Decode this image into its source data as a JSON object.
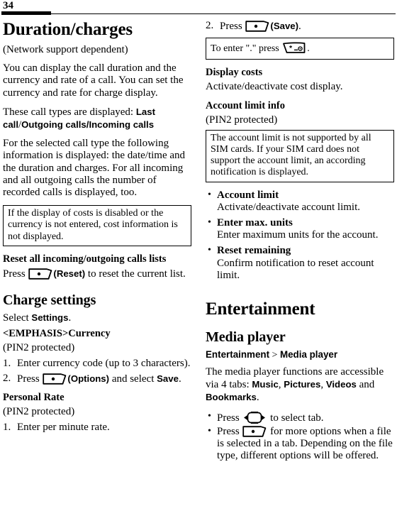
{
  "page": {
    "number": "34"
  },
  "left_column": {
    "chapter_title": "Duration/charges",
    "network_note": "(Network support dependent)",
    "para1": "You can display the call duration and the currency and rate of a call. You can set the currency and rate for charge display.",
    "para2_prefix": "These call types are displayed: ",
    "call_type_1": "Last call",
    "call_type_sep1": "/",
    "call_type_2": "Outgoing calls",
    "call_type_sep2": "/",
    "call_type_3": "Incoming calls",
    "para3": "For the selected call type the following information is displayed: the date/time and the duration and charges. For all incoming and all outgoing calls the number of recorded calls is displayed, too.",
    "note_box_1": "If the display of costs is disabled or the currency is not entered, cost information is not displayed.",
    "reset_heading": "Reset all incoming/outgoing calls lists",
    "reset_press_prefix": "Press ",
    "reset_soft_key": "soft-key-icon",
    "reset_paren_open": "(",
    "reset_label": "Reset",
    "reset_paren_close": ")",
    "reset_suffix": " to reset the current list.",
    "charge_settings_title": "Charge settings",
    "select_prefix": "Select ",
    "select_term": "Settings",
    "select_suffix": ".",
    "currency_heading": "<EMPHASIS>Currency",
    "pin2_note_1": "(PIN2 protected)",
    "currency_steps": [
      {
        "num": "1.",
        "text": "Enter currency code (up to 3 characters)."
      }
    ],
    "currency_step2": {
      "num": "2.",
      "prefix": "Press ",
      "key": "soft-key-icon",
      "paren_open": "(",
      "label": "Options",
      "paren_close": ")",
      "mid": " and select ",
      "label2": "Save",
      "suffix": "."
    },
    "personal_rate_heading": "Personal Rate",
    "pin2_note_2": "(PIN2 protected)",
    "personal_rate_steps": [
      {
        "num": "1.",
        "text": "Enter per minute rate."
      }
    ]
  },
  "right_column": {
    "save_step": {
      "num": "2.",
      "prefix": "Press ",
      "key": "soft-key-icon",
      "paren_open": "(",
      "label": "Save",
      "paren_close": ")",
      "suffix": "."
    },
    "note_box_dot": {
      "prefix": "To enter \".\" press ",
      "key": "star-key-icon",
      "suffix": "."
    },
    "display_costs_heading": "Display costs",
    "display_costs_text": "Activate/deactivate cost display.",
    "account_limit_heading": "Account limit info",
    "pin2_note": "(PIN2 protected)",
    "note_box_account": "The account limit is not supported by all SIM cards. If your SIM card does not support the account limit, an according notification is displayed.",
    "bullets": [
      {
        "title": "Account limit",
        "text": "Activate/deactivate account limit."
      },
      {
        "title": "Enter max. units",
        "text": "Enter maximum units for the account."
      },
      {
        "title": "Reset remaining",
        "text": "Confirm notification to reset account limit."
      }
    ],
    "entertainment_title": "Entertainment",
    "media_player_title": "Media player",
    "breadcrumb_parent": "Entertainment",
    "breadcrumb_sep": " > ",
    "breadcrumb_child": "Media player",
    "media_intro_prefix": "The media player functions are accessible via 4 tabs: ",
    "tab_1": "Music",
    "tab_sep1": ", ",
    "tab_2": "Pictures",
    "tab_sep2": ", ",
    "tab_3": "Videos",
    "tab_sep3": " and ",
    "tab_4": "Bookmarks",
    "tab_end": ".",
    "media_bullets": {
      "b1_prefix": "Press ",
      "b1_key": "nav-key-icon",
      "b1_suffix": " to select tab.",
      "b2_prefix": "Press ",
      "b2_key": "soft-key-icon",
      "b2_suffix": " for more options when a file is selected in a tab. Depending on the file type, different options will be offered."
    },
    "bullet_char": "•"
  },
  "colors": {
    "text": "#000000",
    "background": "#ffffff",
    "rule": "#000000"
  }
}
